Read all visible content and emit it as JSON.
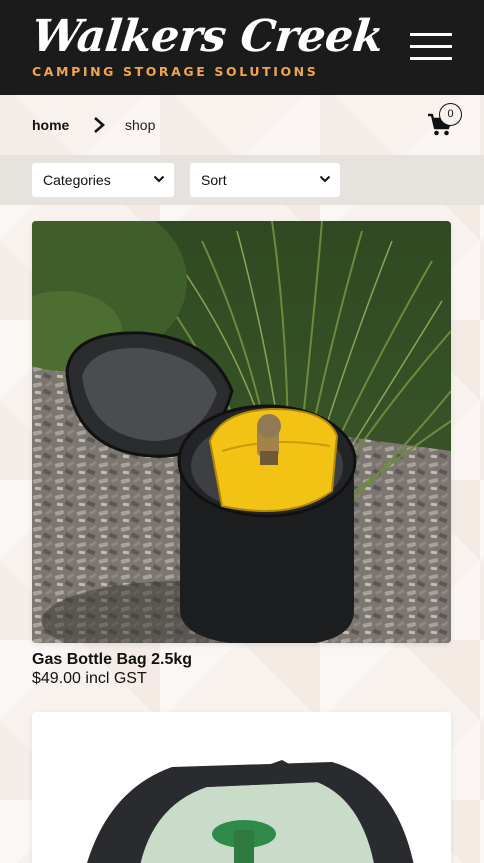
{
  "brand": {
    "title": "Walkers Creek",
    "tagline": "CAMPING STORAGE SOLUTIONS"
  },
  "breadcrumb": {
    "home": "home",
    "current": "shop"
  },
  "cart": {
    "count": "0"
  },
  "filters": {
    "categories_label": "Categories",
    "sort_label": "Sort"
  },
  "products": [
    {
      "name": "Gas Bottle Bag 2.5kg",
      "price": "$49.00 incl GST"
    }
  ],
  "colors": {
    "header_bg": "#1b1b1b",
    "accent": "#f0a64e",
    "filter_bar": "#e6e3de"
  }
}
